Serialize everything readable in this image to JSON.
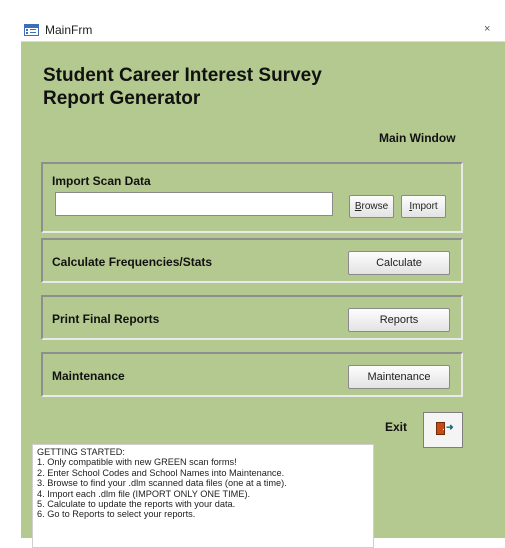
{
  "window": {
    "title": "MainFrm",
    "close_glyph": "×"
  },
  "header": {
    "title_line1": "Student Career Interest Survey",
    "title_line2": "Report Generator",
    "subtitle": "Main Window"
  },
  "import_section": {
    "label": "Import Scan Data",
    "file_value": "",
    "browse_accel": "B",
    "browse_rest": "rowse",
    "import_accel": "I",
    "import_rest": "mport"
  },
  "calc_section": {
    "label": "Calculate Frequencies/Stats",
    "button": "Calculate"
  },
  "reports_section": {
    "label": "Print Final Reports",
    "button": "Reports"
  },
  "maint_section": {
    "label": "Maintenance",
    "button": "Maintenance"
  },
  "exit": {
    "label": "Exit",
    "icon": "exit-door-icon"
  },
  "getting_started": {
    "heading": "GETTING STARTED:",
    "steps": [
      "1. Only compatible with new GREEN scan forms!",
      "2. Enter School Codes and School Names into Maintenance.",
      "3. Browse to find your .dlm scanned data files (one at a time).",
      "4. Import each .dlm file (IMPORT ONLY ONE TIME).",
      "5. Calculate to update the reports with your data.",
      "6. Go to Reports to select your reports."
    ]
  },
  "colors": {
    "form_background": "#b4c98f",
    "exit_door": "#c84a14"
  }
}
